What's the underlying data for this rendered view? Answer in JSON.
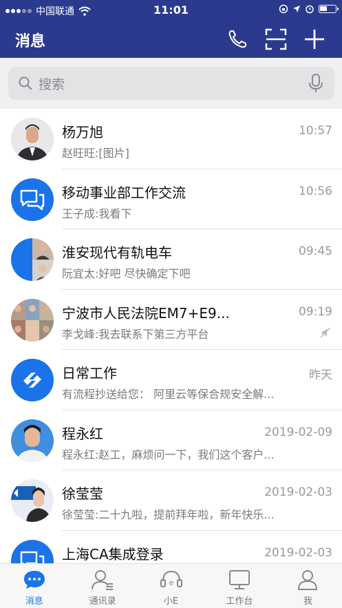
{
  "status_bar": {
    "carrier": "中国联通",
    "time": "11:01"
  },
  "header": {
    "title": "消息"
  },
  "search": {
    "placeholder": "搜索"
  },
  "conversations": [
    {
      "name": "杨万旭",
      "preview": "赵旺旺:[图片]",
      "time": "10:57",
      "avatar": "photo"
    },
    {
      "name": "移动事业部工作交流",
      "preview": "王子成:我看下",
      "time": "10:56",
      "avatar": "chat-bubbles-icon"
    },
    {
      "name": "淮安现代有轨电车",
      "preview": "阮宜太:好吧 尽快确定下吧",
      "time": "09:45",
      "avatar": "group-photo"
    },
    {
      "name": "宁波市人民法院EM7+E9...",
      "preview": "李戈峰:我去联系下第三方平台",
      "time": "09:19",
      "avatar": "group-photo",
      "muted": true
    },
    {
      "name": "日常工作",
      "preview": "有流程抄送给您： 阿里云等保合规安全解...",
      "time": "昨天",
      "avatar": "workflow-icon"
    },
    {
      "name": "程永红",
      "preview": "程永红:赵工，麻烦问一下，我们这个客户...",
      "time": "2019-02-09",
      "avatar": "photo"
    },
    {
      "name": "徐莹莹",
      "preview": "徐莹莹:二十九啦，提前拜年啦，新年快乐...",
      "time": "2019-02-03",
      "avatar": "photo"
    },
    {
      "name": "上海CA集成登录",
      "preview": "",
      "time": "2019-02-03",
      "avatar": "chat-bubbles-icon"
    }
  ],
  "tabs": [
    {
      "label": "消息",
      "icon": "chat-icon",
      "active": true
    },
    {
      "label": "通讯录",
      "icon": "contacts-icon",
      "active": false
    },
    {
      "label": "小E",
      "icon": "assistant-icon",
      "active": false
    },
    {
      "label": "工作台",
      "icon": "workbench-icon",
      "active": false
    },
    {
      "label": "我",
      "icon": "profile-icon",
      "active": false
    }
  ],
  "colors": {
    "nav_bar": "#2b3a8f",
    "accent": "#1a73e8"
  }
}
